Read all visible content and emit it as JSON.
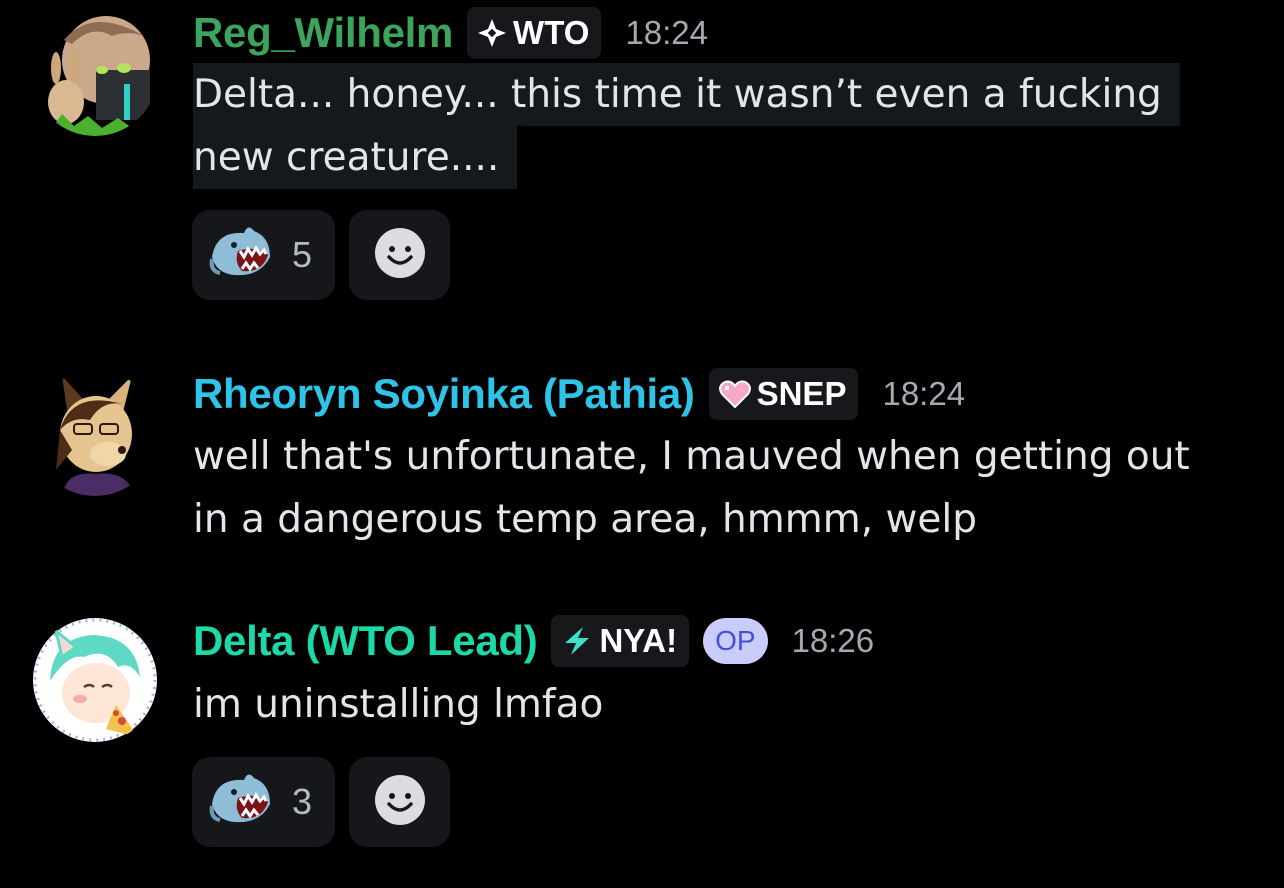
{
  "messages": [
    {
      "username": "Reg_Wilhelm",
      "username_color": "#3ba55d",
      "tag": {
        "icon": "diamond-cross-icon",
        "label": "WTO"
      },
      "timestamp": "18:24",
      "lines": [
        "Delta... honey... this time it wasn’t even a fucking",
        "new creature...."
      ],
      "reactions": [
        {
          "emoji": "shark-emoji",
          "count": "5"
        }
      ],
      "add_reaction_icon": "smiley-add-icon"
    },
    {
      "username": "Rheoryn Soyinka (Pathia)",
      "username_color": "#2ec4e8",
      "tag": {
        "icon": "pink-heart-icon",
        "label": "SNEP"
      },
      "timestamp": "18:24",
      "lines": [
        "well that's unfortunate, I mauved when getting out",
        "in a dangerous temp area, hmmm, welp"
      ]
    },
    {
      "username": "Delta (WTO Lead)",
      "username_color": "#1bd9a8",
      "tag": {
        "icon": "lightning-icon",
        "label": "NYA!"
      },
      "op_badge": "OP",
      "timestamp": "18:26",
      "lines": [
        "im uninstalling lmfao"
      ],
      "reactions": [
        {
          "emoji": "shark-emoji",
          "count": "3"
        }
      ],
      "add_reaction_icon": "smiley-add-icon"
    }
  ]
}
